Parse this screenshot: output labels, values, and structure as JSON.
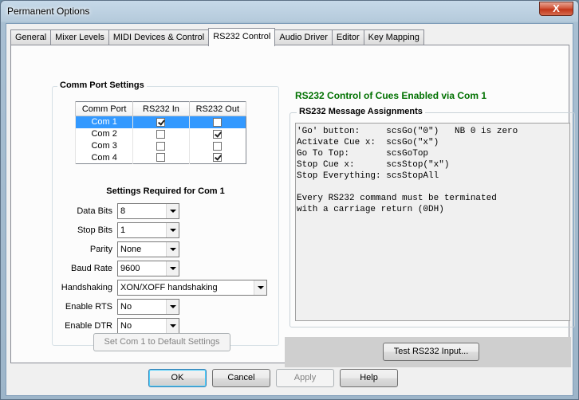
{
  "window": {
    "title": "Permanent Options",
    "close_glyph": "X"
  },
  "tabs": [
    {
      "label": "General"
    },
    {
      "label": "Mixer Levels"
    },
    {
      "label": "MIDI Devices & Control"
    },
    {
      "label": "RS232 Control",
      "active": true
    },
    {
      "label": "Audio Driver"
    },
    {
      "label": "Editor"
    },
    {
      "label": "Key Mapping"
    }
  ],
  "comm_port_settings": {
    "legend": "Comm Port Settings",
    "columns": [
      "Comm Port",
      "RS232 In",
      "RS232 Out"
    ],
    "rows": [
      {
        "port": "Com 1",
        "in": true,
        "out": false,
        "selected": true
      },
      {
        "port": "Com 2",
        "in": false,
        "out": true,
        "selected": false
      },
      {
        "port": "Com 3",
        "in": false,
        "out": false,
        "selected": false
      },
      {
        "port": "Com 4",
        "in": false,
        "out": true,
        "selected": false
      }
    ],
    "settings_title": "Settings Required for Com 1",
    "fields": {
      "data_bits": {
        "label": "Data Bits",
        "value": "8"
      },
      "stop_bits": {
        "label": "Stop Bits",
        "value": "1"
      },
      "parity": {
        "label": "Parity",
        "value": "None"
      },
      "baud_rate": {
        "label": "Baud Rate",
        "value": "9600"
      },
      "handshaking": {
        "label": "Handshaking",
        "value": "XON/XOFF handshaking"
      },
      "enable_rts": {
        "label": "Enable RTS",
        "value": "No"
      },
      "enable_dtr": {
        "label": "Enable DTR",
        "value": "No"
      }
    },
    "default_button": "Set Com 1 to Default Settings"
  },
  "status": {
    "text": "RS232 Control of Cues Enabled via Com 1",
    "color": "#007100"
  },
  "message_assignments": {
    "legend": "RS232 Message Assignments",
    "lines": [
      "'Go' button:     scsGo(\"0\")   NB 0 is zero",
      "Activate Cue x:  scsGo(\"x\")",
      "Go To Top:       scsGoTop",
      "Stop Cue x:      scsStop(\"x\")",
      "Stop Everything: scsStopAll",
      "",
      "Every RS232 command must be terminated",
      "with a carriage return (0DH)"
    ]
  },
  "test_button": "Test RS232 Input...",
  "footer": {
    "ok": "OK",
    "cancel": "Cancel",
    "apply": "Apply",
    "help": "Help"
  },
  "colors": {
    "selection": "#3399ff",
    "status_green": "#007100"
  }
}
